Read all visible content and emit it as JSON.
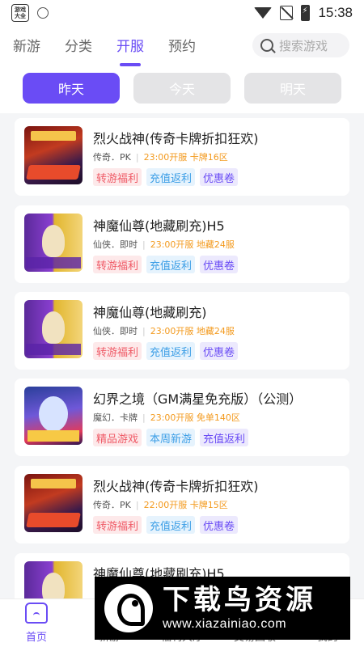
{
  "status_bar": {
    "app_icon_text": "游戏大全",
    "time": "15:38"
  },
  "top_nav": {
    "tabs": [
      {
        "label": "新游"
      },
      {
        "label": "分类"
      },
      {
        "label": "开服"
      },
      {
        "label": "预约"
      }
    ],
    "active_tab": "开服",
    "search_placeholder": "搜索游戏"
  },
  "day_tabs": [
    {
      "label": "昨天"
    },
    {
      "label": "今天"
    },
    {
      "label": "明天"
    }
  ],
  "active_day": "昨天",
  "games": [
    {
      "title": "烈火战神(传奇卡牌折扣狂欢)",
      "genre": "传奇．PK",
      "server_time": "23:00开服 卡牌16区",
      "tags": [
        "转游福利",
        "充值返利",
        "优惠卷"
      ],
      "thumb": "fire-warrior"
    },
    {
      "title": "神魔仙尊(地藏刷充)H5",
      "genre": "仙侠．即时",
      "server_time": "23:00开服 地藏24服",
      "tags": [
        "转游福利",
        "充值返利",
        "优惠卷"
      ],
      "thumb": "god-demon"
    },
    {
      "title": "神魔仙尊(地藏刷充)",
      "genre": "仙侠．即时",
      "server_time": "23:00开服 地藏24服",
      "tags": [
        "转游福利",
        "充值返利",
        "优惠卷"
      ],
      "thumb": "god-demon"
    },
    {
      "title": "幻界之境（GM满星免充版）（公测）",
      "genre": "魔幻．卡牌",
      "server_time": "23:00开服 免单140区",
      "tags": [
        "精品游戏",
        "本周新游",
        "充值返利"
      ],
      "thumb": "magic-realm"
    },
    {
      "title": "烈火战神(传奇卡牌折扣狂欢)",
      "genre": "传奇．PK",
      "server_time": "22:00开服 卡牌15区",
      "tags": [
        "转游福利",
        "充值返利",
        "优惠卷"
      ],
      "thumb": "fire-warrior"
    },
    {
      "title": "神魔仙尊(地藏刷充)H5",
      "genre": "",
      "server_time": "",
      "tags": [],
      "thumb": "god-demon"
    }
  ],
  "bottom_nav": [
    {
      "label": "首页"
    },
    {
      "label": "新游"
    },
    {
      "label": "福利大厅"
    },
    {
      "label": "交易回收"
    },
    {
      "label": "我的"
    }
  ],
  "watermark": {
    "title": "下载鸟资源",
    "url": "www.xiazainiao.com"
  },
  "colors": {
    "accent": "#6a4cf5",
    "tag_red": "#ef5a66",
    "tag_blue": "#3c9ee6",
    "time_orange": "#f39a1e"
  }
}
